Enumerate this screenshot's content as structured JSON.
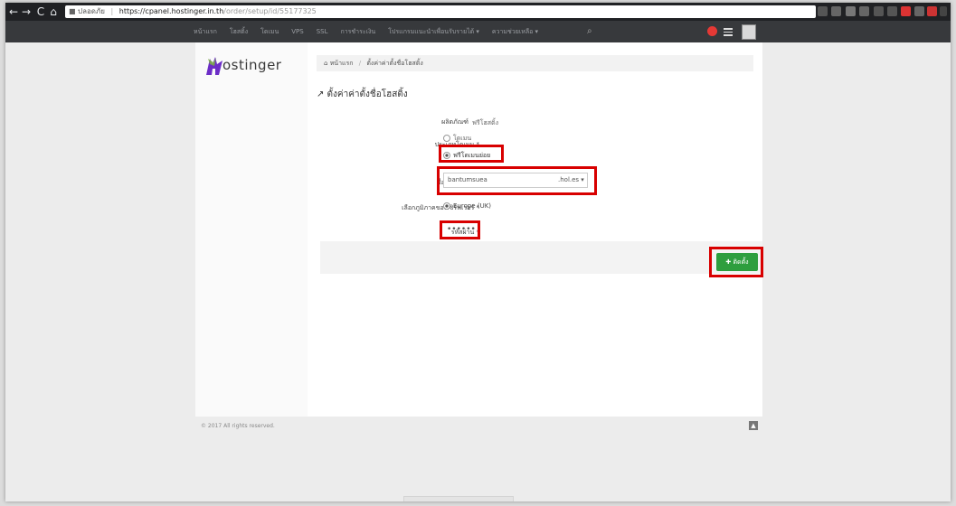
{
  "browser": {
    "back_icon": "←",
    "forward_icon": "→",
    "reload_icon": "C",
    "home_icon": "⌂",
    "secure_label": "ปลอดภัย",
    "url_host": "https://cpanel.hostinger.in.th",
    "url_path": "/order/setup/id/55177325"
  },
  "navbar": {
    "items": [
      "หน้าแรก",
      "โฮสติ้ง",
      "โดเมน",
      "VPS",
      "SSL",
      "การชำระเงิน",
      "โปรแกรมแนะนำเพื่อนรับรายได้ ▾",
      "ความช่วยเหลือ ▾"
    ],
    "search_icon": "⌕",
    "notification_color": "#e53935"
  },
  "sidebar": {
    "logo_text": "ostinger",
    "logo_color": "#6c2dc7"
  },
  "breadcrumb": {
    "home_icon": "⌂",
    "home": "หน้าแรก",
    "separator": "/",
    "current": "ตั้งค่าค่าตั้งชื่อโฮสติ้ง"
  },
  "page": {
    "title": "↗ ตั้งค่าค่าตั้งชื่อโฮสติ้ง"
  },
  "form": {
    "product_label": "ผลิตภัณฑ์",
    "product_value": "ฟรีโฮสติ้ง",
    "domain_type_label": "ประเภทโดเมน *",
    "domain_type_options": [
      "โดเมน",
      "ฟรีโดเมนย่อย"
    ],
    "subdomain_label": "ชื่อโดเมนย่อย *",
    "subdomain_value": "bantumsuea",
    "subdomain_suffix": ".hol.es",
    "server_label": "เลือกภูมิภาคของเซิร์ฟเวอร์ *",
    "server_value": "Europe (UK)",
    "password_label": "รหัสผ่าน *",
    "password_value": "••••••",
    "install_button": "✚ ติดตั้ง"
  },
  "footer": {
    "copyright": "© 2017 All rights reserved.",
    "top_button": "▲"
  },
  "colors": {
    "highlight": "#d80000",
    "install_green": "#2e9e3e",
    "navbar_bg": "#37393c"
  }
}
